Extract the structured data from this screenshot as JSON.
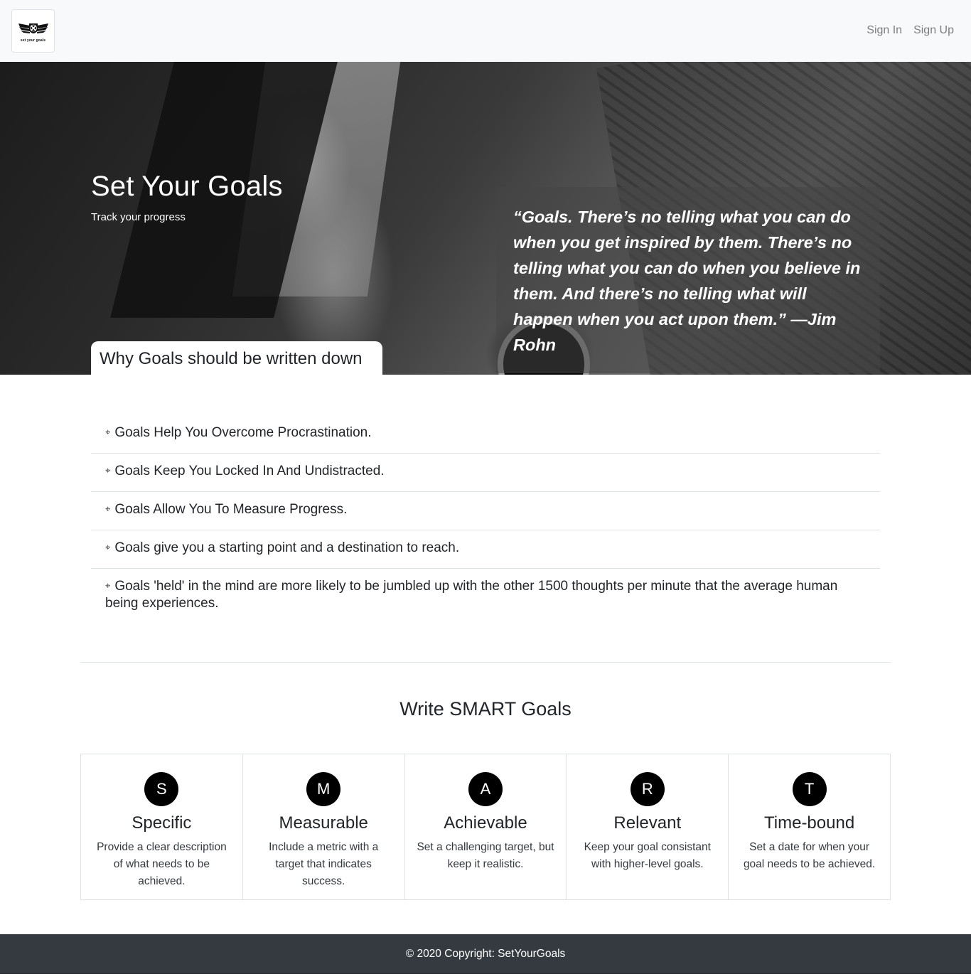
{
  "navbar": {
    "logo_text": "set your goals",
    "links": [
      "Sign In",
      "Sign Up"
    ]
  },
  "hero": {
    "title": "Set Your Goals",
    "subtitle": "Track your progress",
    "quote": "“Goals. There’s no telling what you can do when you get inspired by them. There’s no telling what you can do when you believe in them. And there’s no telling what will happen when you act upon them.” —Jim Rohn",
    "section_tab": "Why Goals should be written down"
  },
  "reasons": {
    "bullet_icon": "⌖",
    "items": [
      "Goals Help You Overcome Procrastination.",
      "Goals Keep You Locked In And Undistracted.",
      "Goals Allow You To Measure Progress.",
      "Goals give you a starting point and a destination to reach.",
      "Goals 'held' in the mind are more likely to be jumbled up with the other 1500 thoughts per minute that the average human being experiences."
    ]
  },
  "smart": {
    "title": "Write SMART Goals",
    "cards": [
      {
        "letter": "S",
        "name": "Specific",
        "desc": "Provide a clear description of what needs to be achieved."
      },
      {
        "letter": "M",
        "name": "Measurable",
        "desc": "Include a metric with a target that indicates success."
      },
      {
        "letter": "A",
        "name": "Achievable",
        "desc": "Set a challenging target, but keep it realistic."
      },
      {
        "letter": "R",
        "name": "Relevant",
        "desc": "Keep your goal consistant with higher-level goals."
      },
      {
        "letter": "T",
        "name": "Time-bound",
        "desc": "Set a date for when your goal needs to be achieved."
      }
    ]
  },
  "footer": {
    "copyright": "© 2020 Copyright: SetYourGoals"
  }
}
